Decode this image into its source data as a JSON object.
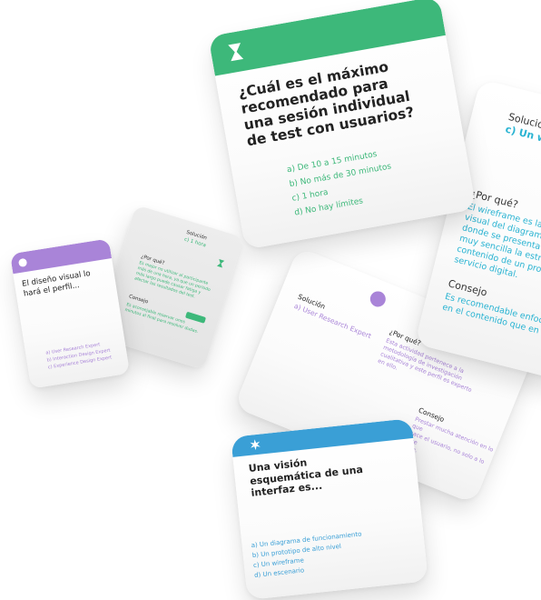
{
  "colors": {
    "green": "#3db87a",
    "purple": "#a984d8",
    "blue": "#3a9fd6",
    "cyan": "#29b3d2",
    "dark": "#222222"
  },
  "cards": {
    "main_green": {
      "icon": "hourglass-icon",
      "question": [
        "¿Cuál es el máximo",
        "recomendado para",
        "una sesión individual",
        "de test con usuarios?"
      ],
      "options": [
        "a) De 10 a 15 minutos",
        "b) No más de 30 minutos",
        "c) 1 hora",
        "d) No hay límites"
      ]
    },
    "right_cyan": {
      "solution_title": "Solución",
      "solution_answer": "c) Un wirefra",
      "why_title": "¿Por qué?",
      "why_text": [
        "El wireframe es la re",
        "visual del diagrama",
        "donde se presenta d",
        "muy sencilla la estruc",
        "contenido de un prod",
        "servicio digital."
      ],
      "tip_title": "Consejo",
      "tip_text": [
        "Es recomendable enfoc",
        "en el contenido que en"
      ]
    },
    "purple_question": {
      "icon": "circle-icon",
      "question": [
        "El diseño visual lo",
        "hará el perfil..."
      ],
      "options": [
        "a) User Research Expert",
        "b) Interaction Design Expert",
        "c) Experience Design Expert"
      ]
    },
    "grey_answer": {
      "solution_title": "Solución",
      "solution_answer": "c) 1 hora",
      "icon": "hourglass-icon",
      "why_title": "¿Por qué?",
      "why_text": "Es mejor no utilizar al participante más de una hora, ya que un periodo más largo puede causar fatiga y afectar los resultados del test.",
      "tip_title": "Consejo",
      "tip_text": "Es aconsejable reservar unos minutos al final para resolver dudas."
    },
    "purple_answer": {
      "icon": "circle-icon",
      "solution_title": "Solución",
      "solution_answer": "a) User Research Expert",
      "why_title": "¿Por qué?",
      "why_text": [
        "Esta actividad pertenece a la",
        "metodología de investigación",
        "cualitativa y este perfil es experto",
        "en ello."
      ],
      "tip_title": "Consejo",
      "tip_text": [
        "Prestar mucha atención en lo que",
        "hace el usuario, no solo a lo que",
        "dice."
      ]
    },
    "blue_question": {
      "icon": "star-icon",
      "question": [
        "Una visión",
        "esquemática de una",
        "interfaz es..."
      ],
      "options": [
        "a) Un diagrama de funcionamiento",
        "b) Un prototipo de alto nivel",
        "c) Un wireframe",
        "d) Un escenario"
      ]
    }
  }
}
